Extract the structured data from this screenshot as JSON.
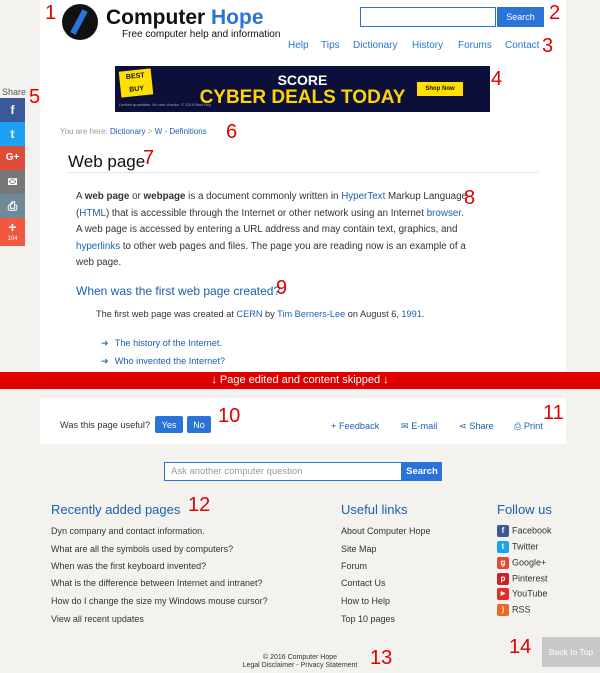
{
  "annotations": [
    "1",
    "2",
    "3",
    "4",
    "5",
    "6",
    "7",
    "8",
    "9",
    "10",
    "11",
    "12",
    "13",
    "14"
  ],
  "header": {
    "brand_part1": "Computer",
    "brand_part2": "Hope",
    "tagline": "Free computer help and information",
    "search_placeholder": "",
    "search_label": "Search",
    "nav": [
      "Help",
      "Tips",
      "Dictionary",
      "History",
      "Forums",
      "Contact"
    ]
  },
  "ad": {
    "brand": "BEST BUY",
    "line1": "SCORE",
    "line2": "CYBER DEALS TODAY",
    "cta": "Shop Now",
    "fine_print": "Limited quantities. No rain checks. © 2016 Best Buy"
  },
  "share": {
    "label": "Share",
    "buttons": [
      {
        "glyph": "f",
        "name": "facebook",
        "color": "#3b5998"
      },
      {
        "glyph": "t",
        "name": "twitter",
        "color": "#1da1f2"
      },
      {
        "glyph": "G+",
        "name": "google-plus",
        "color": "#dd4b39"
      },
      {
        "glyph": "✉",
        "name": "email",
        "color": "#777777"
      },
      {
        "glyph": "⎙",
        "name": "print",
        "color": "#6f8a96"
      },
      {
        "glyph": "+",
        "name": "more",
        "color": "#f0593f",
        "count": "104"
      }
    ]
  },
  "breadcrumb": {
    "prefix": "You are here:",
    "items": [
      "Dictionary",
      "W - Definitions"
    ]
  },
  "article": {
    "title": "Web page",
    "para": {
      "t1": "A ",
      "b1": "web page",
      "t2": " or ",
      "b2": "webpage",
      "t3": " is a document commonly written in ",
      "l1": "HyperText",
      "t4": " Markup Language (",
      "l2": "HTML",
      "t5": ") that is accessible through the Internet or other network using an Internet ",
      "l3": "browser",
      "t6": ". A web page is accessed by entering a URL address and may contain text, graphics, and ",
      "l4": "hyperlinks",
      "t7": " to other web pages and files. The page you are reading now is an example of a web page."
    },
    "subheading": "When was the first web page created?",
    "first": {
      "t1": "The first web page was created at ",
      "l1": "CERN",
      "t2": " by ",
      "l2": "Tim Berners-Lee",
      "t3": " on August 6, ",
      "l3": "1991",
      "t4": "."
    },
    "related": [
      "The history of the Internet.",
      "Who invented the Internet?"
    ]
  },
  "banner": "Page edited and content skipped",
  "feedback_bar": {
    "question": "Was this page useful?",
    "yes": "Yes",
    "no": "No",
    "actions": [
      {
        "glyph": "+",
        "label": "Feedback"
      },
      {
        "glyph": "✉",
        "label": "E-mail"
      },
      {
        "glyph": "⋖",
        "label": "Share"
      },
      {
        "glyph": "⎙",
        "label": "Print"
      }
    ]
  },
  "ask": {
    "placeholder": "Ask another computer question",
    "button": "Search"
  },
  "footer": {
    "recent": {
      "title": "Recently added pages",
      "items": [
        "Dyn company and contact information.",
        "What are all the symbols used by computers?",
        "When was the first keyboard invented?",
        "What is the difference between Internet and intranet?",
        "How do I change the size my Windows mouse cursor?",
        "View all recent updates"
      ]
    },
    "useful": {
      "title": "Useful links",
      "items": [
        "About Computer Hope",
        "Site Map",
        "Forum",
        "Contact Us",
        "How to Help",
        "Top 10 pages"
      ]
    },
    "follow": {
      "title": "Follow us",
      "items": [
        {
          "label": "Facebook",
          "glyph": "f",
          "color": "#3b5998"
        },
        {
          "label": "Twitter",
          "glyph": "t",
          "color": "#1da1f2"
        },
        {
          "label": "Google+",
          "glyph": "g",
          "color": "#dd4b39"
        },
        {
          "label": "Pinterest",
          "glyph": "p",
          "color": "#cb2027"
        },
        {
          "label": "YouTube",
          "glyph": "▶",
          "color": "#e52d27"
        },
        {
          "label": "RSS",
          "glyph": ")",
          "color": "#f26522"
        }
      ]
    },
    "copyright": "© 2016 Computer Hope",
    "legal": [
      "Legal Disclaimer",
      "Privacy Statement"
    ]
  },
  "back_to_top": "Back to Top"
}
